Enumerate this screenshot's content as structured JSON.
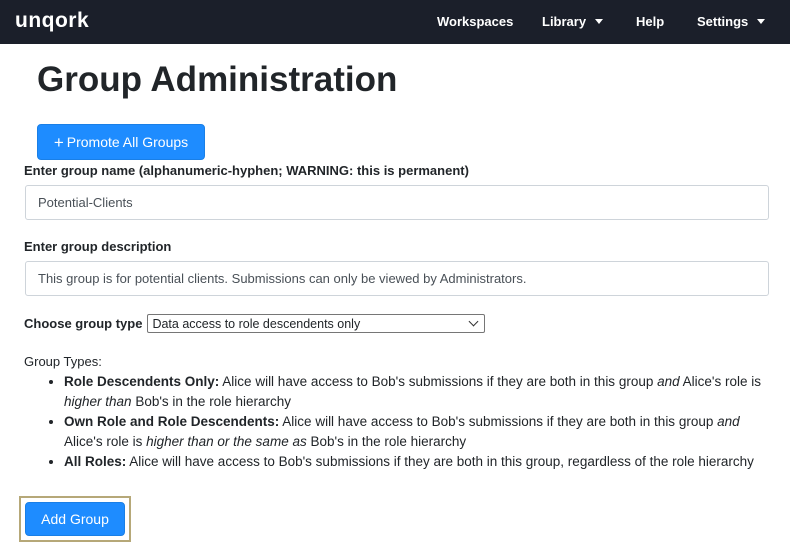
{
  "nav": {
    "logo": "unqork",
    "workspaces": "Workspaces",
    "library": "Library",
    "help": "Help",
    "settings": "Settings"
  },
  "page": {
    "title": "Group Administration",
    "promote_button": "Promote All Groups"
  },
  "form": {
    "name_label": "Enter group name (alphanumeric-hyphen; WARNING: this is permanent)",
    "name_value": "Potential-Clients",
    "description_label": "Enter group description",
    "description_value": "This group is for potential clients. Submissions can only be viewed by Administrators.",
    "type_label": "Choose group type",
    "type_value": "Data access to role descendents only"
  },
  "group_types": {
    "title": "Group Types:",
    "items": [
      {
        "name": "Role Descendents Only:",
        "text_a": " Alice will have access to Bob's submissions if they are both in this group ",
        "em_a": "and",
        "text_b": " Alice's role is ",
        "em_b": "higher than",
        "text_c": " Bob's in the role hierarchy"
      },
      {
        "name": "Own Role and Role Descendents:",
        "text_a": " Alice will have access to Bob's submissions if they are both in this group ",
        "em_a": "and",
        "text_b": " Alice's role is ",
        "em_b": "higher than or the same as",
        "text_c": " Bob's in the role hierarchy"
      },
      {
        "name": "All Roles:",
        "text_a": " Alice will have access to Bob's submissions if they are both in this group, regardless of the role hierarchy"
      }
    ]
  },
  "actions": {
    "add_group": "Add Group"
  }
}
